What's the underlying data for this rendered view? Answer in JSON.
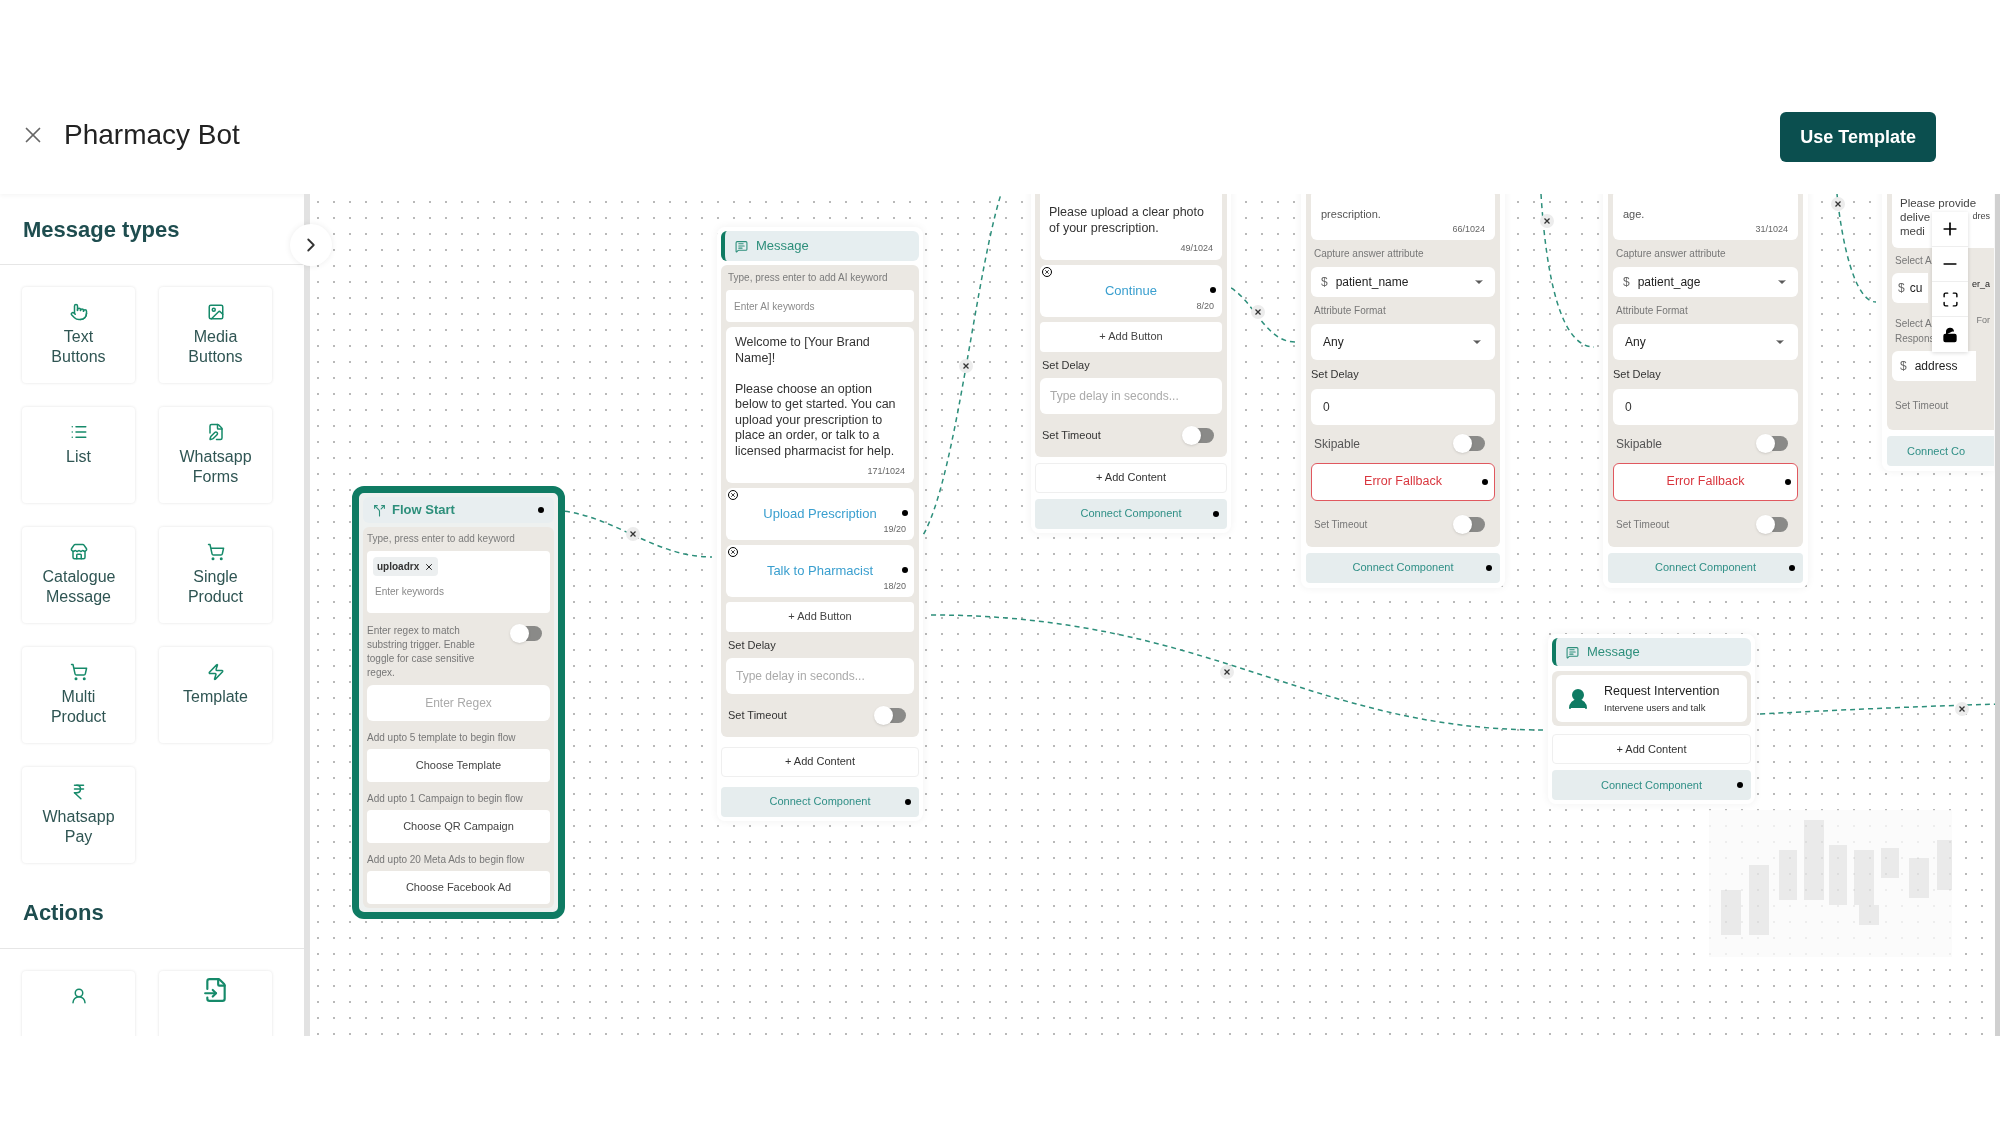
{
  "header": {
    "title": "Pharmacy Bot",
    "action": "Use Template"
  },
  "sidebar": {
    "message_types": {
      "title": "Message types",
      "items": [
        {
          "label": "Text Buttons"
        },
        {
          "label": "Media Buttons"
        },
        {
          "label": "List"
        },
        {
          "label": "Whatsapp Forms"
        },
        {
          "label": "Catalogue Message"
        },
        {
          "label": "Single Product"
        },
        {
          "label": "Multi Product"
        },
        {
          "label": "Template"
        },
        {
          "label": "Whatsapp Pay"
        }
      ]
    },
    "actions": {
      "title": "Actions"
    }
  },
  "nodes": [
    {
      "kind": "flow_start",
      "title": "Flow Start",
      "keyword_label": "Type, press enter to add keyword",
      "keywords": [
        "uploadrx"
      ],
      "keyword_placeholder": "Enter keywords",
      "regex_label": "Enter regex to match substring trigger. Enable toggle for case sensitive regex.",
      "regex_case_sensitive": false,
      "regex_placeholder": "Enter Regex",
      "choosers": [
        {
          "hint": "Add upto 5 template to begin flow",
          "button": "Choose Template"
        },
        {
          "hint": "Add upto 1 Campaign to begin flow",
          "button": "Choose QR Campaign"
        },
        {
          "hint": "Add upto 20 Meta Ads to begin flow",
          "button": "Choose Facebook Ad"
        }
      ]
    },
    {
      "kind": "message",
      "title": "Message",
      "ai_label": "Type, press enter to add AI keyword",
      "ai_placeholder": "Enter AI keywords",
      "text": "Welcome to [Your Brand Name]!\n\nPlease choose an option below to get started. You can upload your prescription to place an order, or talk to a licensed pharmacist for help.",
      "count": "171/1024",
      "buttons": [
        {
          "label": "Upload Prescription",
          "count": "19/20"
        },
        {
          "label": "Talk to Pharmacist",
          "count": "18/20"
        }
      ],
      "add_button": "+ Add Button",
      "delay_label": "Set Delay",
      "delay_placeholder": "Type delay in seconds...",
      "timeout_label": "Set Timeout",
      "timeout": false,
      "add_content": "+ Add Content",
      "connect": "Connect Component"
    },
    {
      "kind": "message_cut",
      "text": "Please upload a clear photo of your prescription.",
      "count": "49/1024",
      "buttons": [
        {
          "label": "Continue",
          "count": "8/20"
        }
      ],
      "add_button": "+ Add Button",
      "delay_label": "Set Delay",
      "delay_placeholder": "Type delay in seconds...",
      "timeout_label": "Set Timeout",
      "timeout": false,
      "add_content": "+ Add Content",
      "connect": "Connect Component"
    },
    {
      "kind": "question",
      "text": "prescription.",
      "count": "66/1024",
      "capture_label": "Capture answer attribute",
      "attribute_prefix": "$",
      "attribute": "patient_name",
      "format_label": "Attribute Format",
      "format": "Any",
      "delay_label": "Set Delay",
      "delay": "0",
      "skipable_label": "Skipable",
      "skipable": false,
      "fallback": "Error Fallback",
      "timeout_label": "Set Timeout",
      "timeout": false,
      "connect": "Connect Component"
    },
    {
      "kind": "question",
      "text": "age.",
      "count": "31/1024",
      "capture_label": "Capture answer attribute",
      "attribute_prefix": "$",
      "attribute": "patient_age",
      "format_label": "Attribute Format",
      "format": "Any",
      "delay_label": "Set Delay",
      "delay": "0",
      "skipable_label": "Skipable",
      "skipable": false,
      "fallback": "Error Fallback",
      "timeout_label": "Set Timeout",
      "timeout": false,
      "connect": "Connect Component"
    },
    {
      "kind": "question_cut",
      "text_lines": [
        "Please provide",
        "delive",
        "medi"
      ],
      "text_right": "dres",
      "label_1": "Select A",
      "attribute_1_prefix": "$",
      "attribute_1": "cu",
      "attribute_1_right": "er_a",
      "label_2": "Select A",
      "label_2_right": "For",
      "label_2_line_2": "Respons",
      "attribute_2_prefix": "$",
      "attribute_2": "address",
      "timeout_label": "Set Timeout",
      "connect": "Connect Co"
    },
    {
      "kind": "intervention",
      "title": "Message",
      "item_title": "Request Intervention",
      "item_subtitle": "Intervene users and talk",
      "add_content": "+ Add Content",
      "connect": "Connect Component"
    }
  ]
}
